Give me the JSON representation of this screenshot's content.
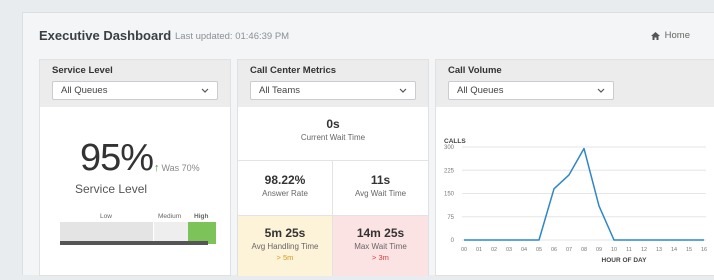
{
  "header": {
    "title": "Executive Dashboard",
    "last_updated": "Last updated: 01:46:39 PM",
    "home_label": "Home"
  },
  "service_level": {
    "title": "Service Level",
    "select_value": "All Queues",
    "value": "95%",
    "was": "Was 70%",
    "label": "Service Level",
    "gauge_labels": {
      "low": "Low",
      "medium": "Medium",
      "high": "High"
    },
    "gauge_level": 0.95,
    "colors": {
      "low": "#e4e4e4",
      "medium": "#eeeeee",
      "high": "#7cc35a",
      "bar": "#555555"
    }
  },
  "metrics": {
    "title": "Call Center Metrics",
    "select_value": "All Teams",
    "current_wait": {
      "value": "0s",
      "label": "Current Wait Time"
    },
    "answer_rate": {
      "value": "98.22%",
      "label": "Answer Rate"
    },
    "avg_wait": {
      "value": "11s",
      "label": "Avg Wait Time"
    },
    "avg_handling": {
      "value": "5m 25s",
      "label": "Avg Handling Time",
      "threshold": "> 5m"
    },
    "max_wait": {
      "value": "14m 25s",
      "label": "Max Wait Time",
      "threshold": "> 3m"
    },
    "colors": {
      "warn_bg": "#fdf3d8",
      "warn_text": "#d39a1a",
      "alert_bg": "#fce3e3",
      "alert_text": "#d43d3d"
    }
  },
  "call_volume": {
    "title": "Call Volume",
    "select_value": "All Queues"
  },
  "chart_data": {
    "type": "line",
    "title": "",
    "ylabel": "CALLS",
    "xlabel": "HOUR OF DAY",
    "x": [
      "00",
      "01",
      "02",
      "03",
      "04",
      "05",
      "06",
      "07",
      "08",
      "09",
      "10",
      "11",
      "12",
      "13",
      "14",
      "15",
      "16"
    ],
    "series": [
      {
        "values": [
          0,
          0,
          0,
          0,
          0,
          0,
          165,
          210,
          295,
          110,
          0,
          0,
          0,
          0,
          0,
          0,
          0
        ]
      }
    ],
    "y_ticks": [
      0,
      75,
      150,
      225,
      300
    ],
    "ylim": [
      0,
      300
    ],
    "grid": true,
    "line_color": "#2e86c9"
  }
}
